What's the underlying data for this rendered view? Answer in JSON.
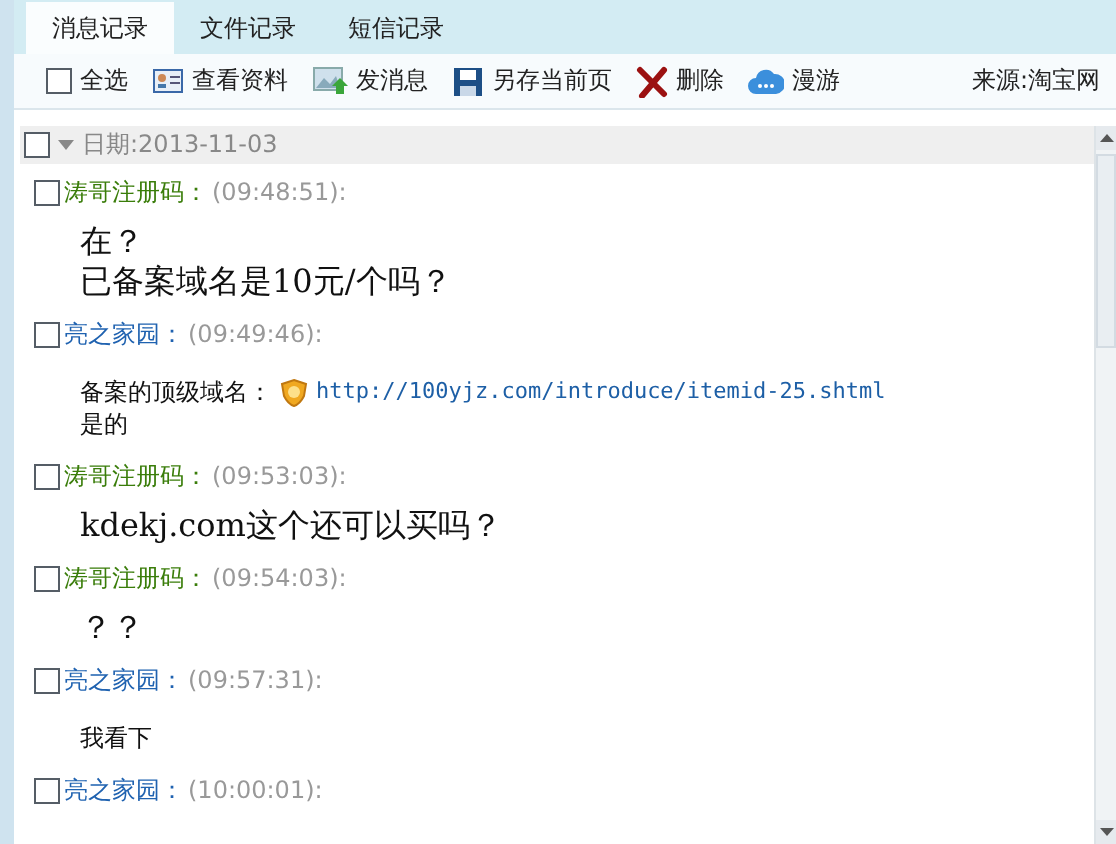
{
  "tabs": [
    {
      "label": "消息记录",
      "selected": true
    },
    {
      "label": "文件记录",
      "selected": false
    },
    {
      "label": "短信记录",
      "selected": false
    }
  ],
  "toolbar": {
    "select_all": {
      "label": "全选",
      "checked": false
    },
    "buttons": [
      {
        "kind": "profile",
        "label": "查看资料"
      },
      {
        "kind": "message",
        "label": "发消息"
      },
      {
        "kind": "save",
        "label": "另存当前页"
      },
      {
        "kind": "delete",
        "label": "删除"
      },
      {
        "kind": "roam",
        "label": "漫游"
      }
    ],
    "source": "来源:淘宝网"
  },
  "date_group": {
    "label": "日期:2013-11-03",
    "checked": false,
    "expanded": true
  },
  "messages": [
    {
      "sender": "涛哥注册码：",
      "color": "#3a7d0a",
      "time": "(09:48:51):",
      "checked": false,
      "kind": "large",
      "lines": [
        {
          "text": "在？"
        },
        {
          "text": "已备案域名是10元/个吗？"
        }
      ]
    },
    {
      "sender": "亮之家园：",
      "color": "#1f62b0",
      "time": "(09:49:46):",
      "checked": false,
      "kind": "small",
      "lines": [
        {
          "text": "备案的顶级域名：",
          "link": "http://100yjz.com/introduce/itemid-25.shtml"
        },
        {
          "text": "是的"
        }
      ]
    },
    {
      "sender": "涛哥注册码：",
      "color": "#3a7d0a",
      "time": "(09:53:03):",
      "checked": false,
      "kind": "large",
      "lines": [
        {
          "text": "kdekj.com这个还可以买吗？"
        }
      ]
    },
    {
      "sender": "涛哥注册码：",
      "color": "#3a7d0a",
      "time": "(09:54:03):",
      "checked": false,
      "kind": "large",
      "lines": [
        {
          "text": "？？"
        }
      ]
    },
    {
      "sender": "亮之家园：",
      "color": "#1f62b0",
      "time": "(09:57:31):",
      "checked": false,
      "kind": "small",
      "lines": [
        {
          "text": "我看下"
        }
      ]
    },
    {
      "sender": "亮之家园：",
      "color": "#1f62b0",
      "time": "(10:00:01):",
      "checked": false
    }
  ]
}
